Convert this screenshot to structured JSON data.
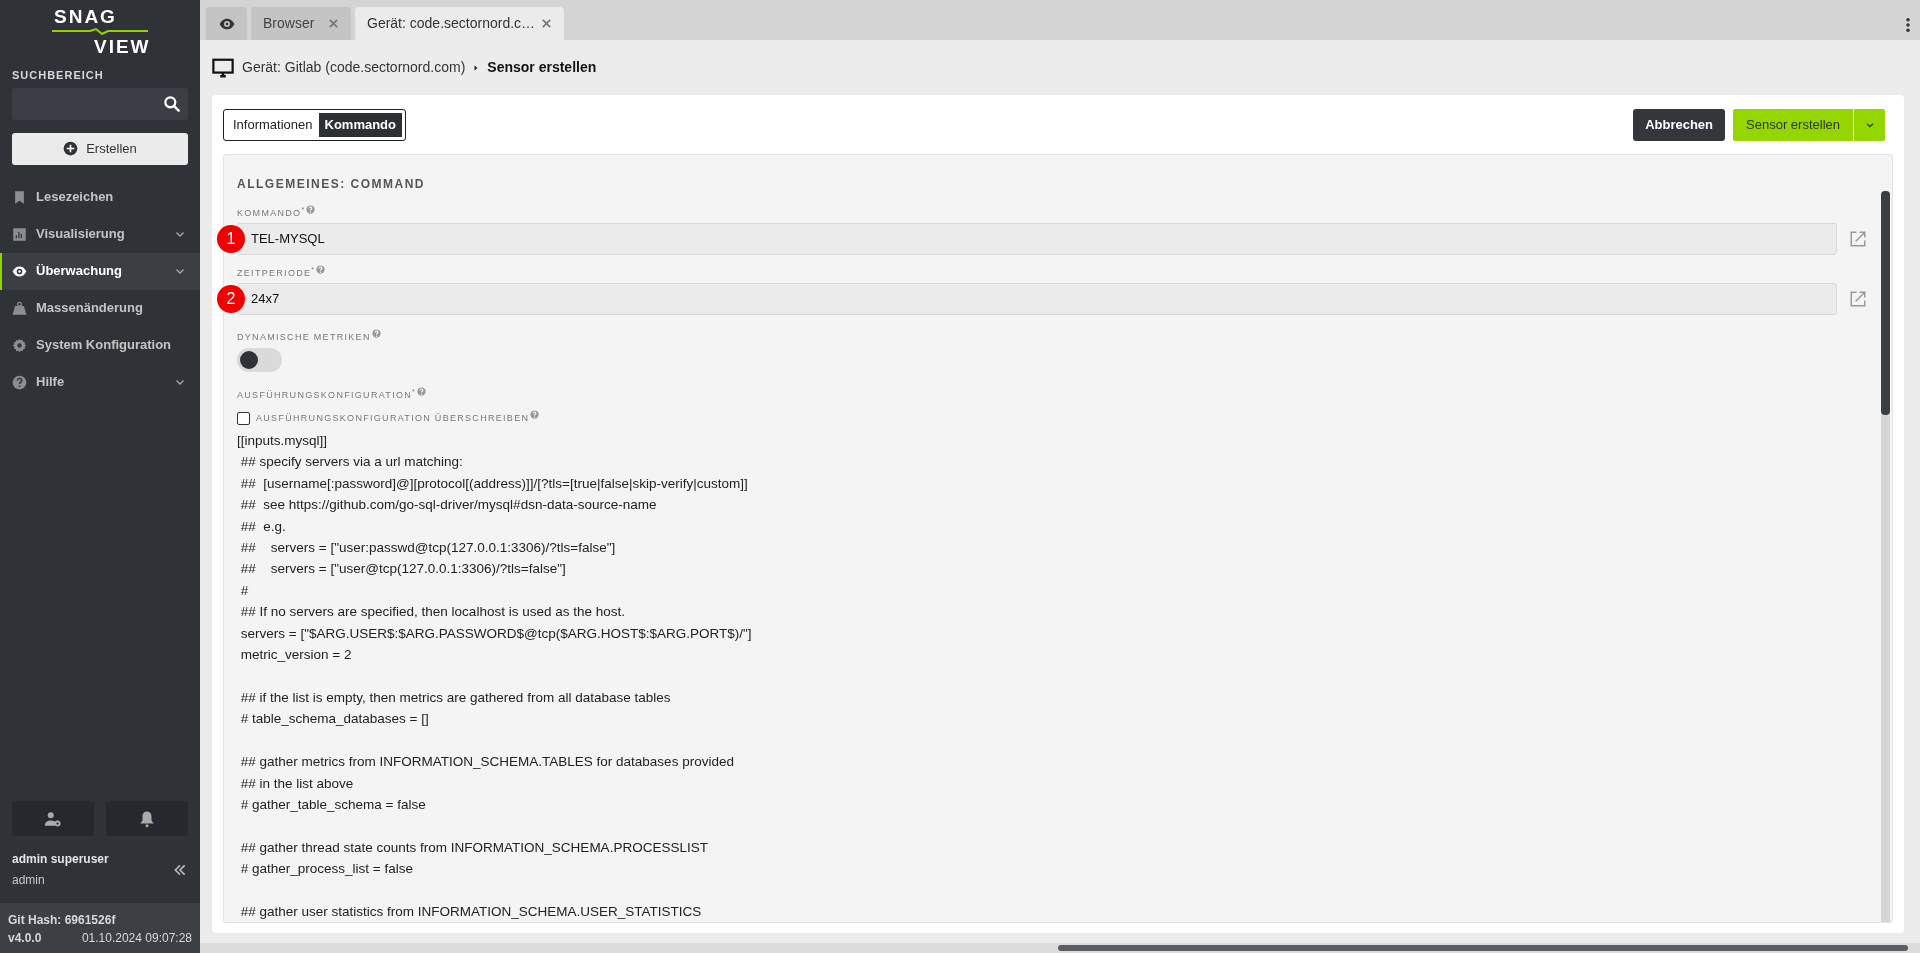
{
  "sidebar": {
    "logo": {
      "top": "SNAG",
      "bottom": "VIEW"
    },
    "search_label": "SUCHBEREICH",
    "create_button": "Erstellen",
    "items": [
      {
        "label": "Lesezeichen",
        "selected": false,
        "expandable": false
      },
      {
        "label": "Visualisierung",
        "selected": false,
        "expandable": true
      },
      {
        "label": "Überwachung",
        "selected": true,
        "expandable": true
      },
      {
        "label": "Massenänderung",
        "selected": false,
        "expandable": false
      },
      {
        "label": "System Konfiguration",
        "selected": false,
        "expandable": false
      },
      {
        "label": "Hilfe",
        "selected": false,
        "expandable": true
      }
    ],
    "user": {
      "name": "admin superuser",
      "login": "admin"
    },
    "footer": {
      "git_hash": "Git Hash: 6961526f",
      "version": "v4.0.0",
      "timestamp": "01.10.2024 09:07:28"
    }
  },
  "tabs": [
    {
      "kind": "icon",
      "selected": false
    },
    {
      "kind": "text",
      "label": "Browser",
      "selected": false
    },
    {
      "kind": "text",
      "label": "Gerät: code.sectornord.c…",
      "selected": true
    }
  ],
  "breadcrumb": {
    "device": "Gerät: Gitlab (code.sectornord.com)",
    "current": "Sensor erstellen"
  },
  "view_switch": [
    {
      "label": "Informationen",
      "selected": false
    },
    {
      "label": "Kommando",
      "selected": true
    }
  ],
  "actions": {
    "cancel": "Abbrechen",
    "submit": "Sensor erstellen"
  },
  "section_title": "ALLGEMEINES: COMMAND",
  "fields": [
    {
      "label": "KOMMANDO$^{*}$",
      "value": "TEL-MYSQL",
      "marker": "1"
    },
    {
      "label": "ZEITPERIODE$^{*}$",
      "value": "24x7",
      "marker": "2"
    }
  ],
  "toggle": {
    "label": "DYNAMISCHE METRIKEN",
    "on": false
  },
  "exec_config": {
    "label": "AUSFÜHRUNGSKONFIGURATION$^{*}$",
    "override_label": "AUSFÜHRUNGSKONFIGURATION ÜBERSCHREIBEN",
    "checked": false,
    "code": "[[inputs.mysql]]\n ## specify servers via a url matching:\n ##  [username[:password]@][protocol[(address)]]/[?tls=[true|false|skip-verify|custom]]\n ##  see https://github.com/go-sql-driver/mysql#dsn-data-source-name\n ##  e.g.\n ##    servers = [\"user:passwd@tcp(127.0.0.1:3306)/?tls=false\"]\n ##    servers = [\"user@tcp(127.0.0.1:3306)/?tls=false\"]\n #\n ## If no servers are specified, then localhost is used as the host.\n servers = [\"$ARG.USER$:$ARG.PASSWORD$@tcp($ARG.HOST$:$ARG.PORT$)/\"]\n metric_version = 2\n\n ## if the list is empty, then metrics are gathered from all database tables\n # table_schema_databases = []\n\n ## gather metrics from INFORMATION_SCHEMA.TABLES for databases provided\n ## in the list above\n # gather_table_schema = false\n\n ## gather thread state counts from INFORMATION_SCHEMA.PROCESSLIST\n # gather_process_list = false\n\n ## gather user statistics from INFORMATION_SCHEMA.USER_STATISTICS"
  }
}
